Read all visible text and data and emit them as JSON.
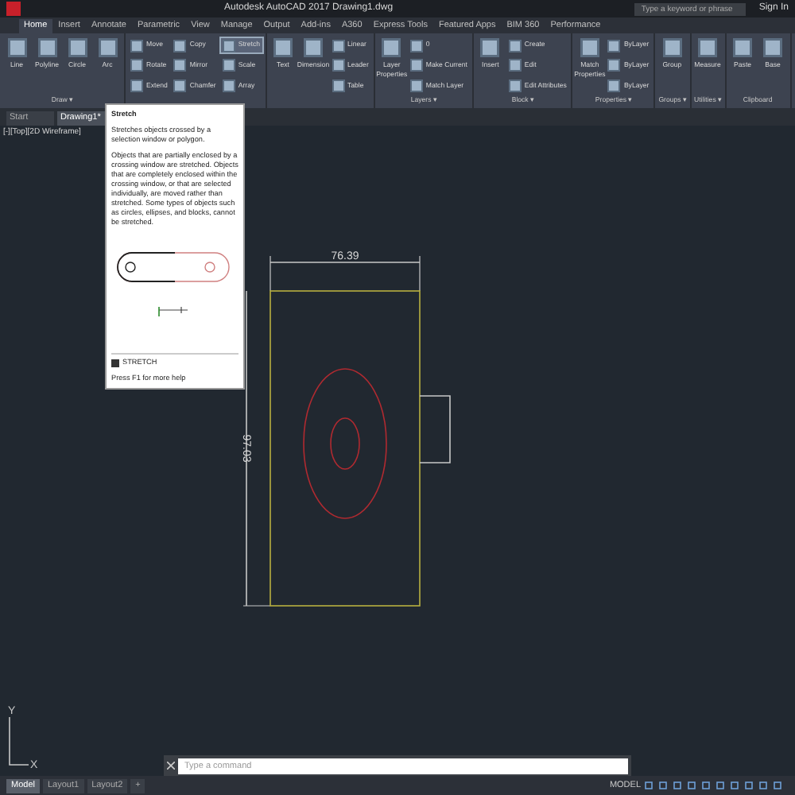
{
  "title_bar": {
    "title": "Autodesk AutoCAD 2017   Drawing1.dwg",
    "search": {
      "placeholder": "Type a keyword or phrase"
    },
    "sign_in": "Sign In"
  },
  "ribbon_tabs": [
    {
      "label": "Home",
      "selected": true
    },
    {
      "label": "Insert",
      "selected": false
    },
    {
      "label": "Annotate",
      "selected": false
    },
    {
      "label": "Parametric",
      "selected": false
    },
    {
      "label": "View",
      "selected": false
    },
    {
      "label": "Manage",
      "selected": false
    },
    {
      "label": "Output",
      "selected": false
    },
    {
      "label": "Add-ins",
      "selected": false
    },
    {
      "label": "A360",
      "selected": false
    },
    {
      "label": "Express Tools",
      "selected": false
    },
    {
      "label": "Featured Apps",
      "selected": false
    },
    {
      "label": "BIM 360",
      "selected": false
    },
    {
      "label": "Performance",
      "selected": false
    }
  ],
  "panels": [
    {
      "label": "Draw ▾",
      "large": [
        "Line",
        "Polyline",
        "Circle",
        "Arc"
      ]
    },
    {
      "small": [
        {
          "label": "Move",
          "selected": false
        },
        {
          "label": "Rotate",
          "selected": false
        },
        {
          "label": "Extend",
          "selected": false
        },
        {
          "label": "Copy",
          "selected": false
        },
        {
          "label": "Mirror",
          "selected": false
        },
        {
          "label": "Chamfer",
          "selected": false
        },
        {
          "label": "Stretch",
          "selected": true
        },
        {
          "label": "Scale",
          "selected": false
        },
        {
          "label": "Array",
          "selected": false
        }
      ]
    },
    {
      "large": [
        "Text",
        "Dimension"
      ],
      "small": [
        {
          "label": "Linear",
          "selected": false
        },
        {
          "label": "Leader",
          "selected": false
        },
        {
          "label": "Table",
          "selected": false
        }
      ]
    },
    {
      "label": "Layers ▾",
      "large": [
        "Layer Properties"
      ],
      "small": [
        {
          "label": "0",
          "selected": false
        },
        {
          "label": "Make Current",
          "selected": false
        },
        {
          "label": "Match Layer",
          "selected": false
        }
      ]
    },
    {
      "label": "Block ▾",
      "large": [
        "Insert"
      ],
      "small": [
        {
          "label": "Create",
          "selected": false
        },
        {
          "label": "Edit",
          "selected": false
        },
        {
          "label": "Edit Attributes",
          "selected": false
        }
      ]
    },
    {
      "label": "Properties ▾",
      "large": [
        "Match Properties"
      ],
      "small": [
        {
          "label": "ByLayer",
          "selected": false
        },
        {
          "label": "ByLayer",
          "selected": false
        },
        {
          "label": "ByLayer",
          "selected": false
        }
      ]
    },
    {
      "label": "Groups ▾",
      "large": [
        "Group"
      ]
    },
    {
      "label": "Utilities ▾",
      "large": [
        "Measure"
      ]
    },
    {
      "label": "Clipboard",
      "large": [
        "Paste",
        "Base"
      ]
    }
  ],
  "file_tabs": [
    {
      "label": "Start",
      "selected": false
    },
    {
      "label": "Drawing1*",
      "selected": true
    }
  ],
  "viewport_label": "[-][Top][2D Wireframe]",
  "tooltip": {
    "title": "Stretch",
    "description": "Stretches objects crossed by a selection window or polygon.",
    "details": "Objects that are partially enclosed by a crossing window are stretched. Objects that are completely enclosed within the crossing window, or that are selected individually, are moved rather than stretched. Some types of objects such as circles, ellipses, and blocks, cannot be stretched.",
    "command": "STRETCH",
    "help": "Press F1 for more help"
  },
  "drawing": {
    "width_dimension": "76.39",
    "height_dimension": "97.03"
  },
  "ucs": {
    "y": "Y",
    "x": "X"
  },
  "command_line": {
    "placeholder": "Type a command"
  },
  "layout_tabs": [
    {
      "label": "Model",
      "selected": true
    },
    {
      "label": "Layout1",
      "selected": false
    },
    {
      "label": "Layout2",
      "selected": false
    },
    {
      "label": "+",
      "selected": false
    }
  ],
  "status_mode": "MODEL"
}
